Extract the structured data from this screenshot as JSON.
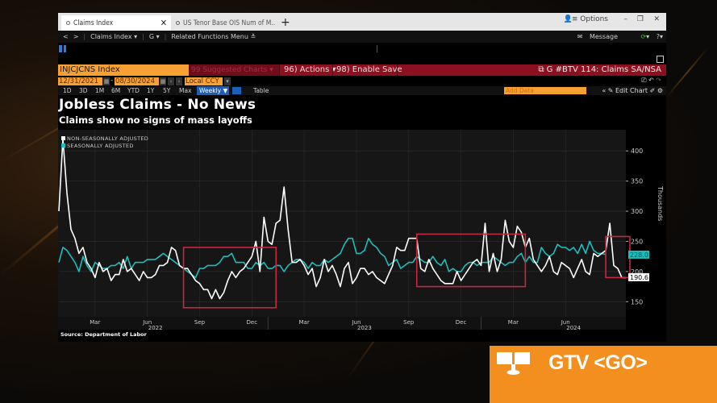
{
  "tabs": [
    {
      "label": "Claims Index",
      "active": true
    },
    {
      "label": "US Tenor Base OIS Num of M..",
      "active": false
    }
  ],
  "window_controls": {
    "options_label": "Options"
  },
  "navbar": {
    "back": "<",
    "forward": ">",
    "security": "Claims Index ▾",
    "g_menu": "G ▾",
    "related": "Related Functions Menu ≚",
    "message": "Message"
  },
  "toolbar": {
    "ticker": "INJCJCNS Index",
    "suggested": "99 Suggested Charts ▾",
    "actions": "96) Actions ▾",
    "enable_save": "98) Enable Save",
    "chart_id": "G #BTV 114: Claims SA/NSA"
  },
  "dates": {
    "start": "12/31/2021",
    "end": "08/30/2024",
    "currency": "Local CCY"
  },
  "periods": [
    "1D",
    "3D",
    "1M",
    "6M",
    "YTD",
    "1Y",
    "5Y",
    "Max"
  ],
  "frequency": "Weekly ▼",
  "table_label": "Table",
  "add_data_placeholder": "Add Data",
  "edit_chart_label": "Edit Chart",
  "source": "Source: Department of Labor",
  "gtv": {
    "label": "GTV <GO>"
  },
  "colors": {
    "nsa": "#ffffff",
    "sa": "#1fbcbc",
    "highlight": "#c8283c",
    "accent_orange": "#f7a033",
    "toolbar_red": "#8b1020"
  },
  "chart_data": {
    "type": "line",
    "title": "Jobless Claims - No News",
    "subtitle": "Claims show no signs of mass layoffs",
    "ylabel": "Thousands",
    "ylim": [
      125,
      435
    ],
    "yticks": [
      150,
      200,
      250,
      300,
      350,
      400
    ],
    "x_start": "2021-12-31",
    "x_end": "2024-08-30",
    "frequency": "weekly",
    "xtick_labels": [
      {
        "label": "Mar",
        "week": 9
      },
      {
        "label": "Jun",
        "week": 22
      },
      {
        "label": "Sep",
        "week": 35
      },
      {
        "label": "Dec",
        "week": 48
      },
      {
        "label": "Mar",
        "week": 61
      },
      {
        "label": "Jun",
        "week": 74
      },
      {
        "label": "Sep",
        "week": 87
      },
      {
        "label": "Dec",
        "week": 100
      },
      {
        "label": "Mar",
        "week": 113
      },
      {
        "label": "Jun",
        "week": 126
      }
    ],
    "year_labels": [
      {
        "label": "2022",
        "week": 24
      },
      {
        "label": "2023",
        "week": 76
      },
      {
        "label": "2024",
        "week": 128
      }
    ],
    "year_dividers": [
      52,
      105
    ],
    "legend": [
      "NON-SEASONALLY ADJUSTED",
      "SEASONALLY ADJUSTED"
    ],
    "legend_position": "top-left",
    "series": [
      {
        "name": "NON-SEASONALLY ADJUSTED",
        "color": "#ffffff",
        "last_value": 190.6,
        "values": [
          300,
          420,
          330,
          270,
          255,
          230,
          240,
          215,
          205,
          190,
          215,
          200,
          205,
          185,
          195,
          195,
          220,
          200,
          205,
          195,
          185,
          200,
          190,
          190,
          195,
          210,
          210,
          215,
          240,
          235,
          210,
          205,
          205,
          195,
          185,
          180,
          170,
          170,
          155,
          170,
          155,
          165,
          185,
          200,
          190,
          200,
          205,
          215,
          225,
          250,
          200,
          290,
          250,
          245,
          280,
          285,
          340,
          270,
          215,
          215,
          220,
          210,
          195,
          205,
          175,
          190,
          220,
          200,
          210,
          195,
          175,
          205,
          215,
          180,
          190,
          205,
          205,
          195,
          200,
          190,
          185,
          180,
          195,
          210,
          240,
          235,
          235,
          255,
          255,
          255,
          205,
          200,
          220,
          205,
          195,
          185,
          180,
          180,
          180,
          200,
          185,
          195,
          205,
          215,
          220,
          210,
          280,
          200,
          230,
          200,
          220,
          285,
          250,
          240,
          275,
          265,
          240,
          255,
          220,
          210,
          200,
          210,
          225,
          200,
          195,
          215,
          210,
          205,
          190,
          205,
          220,
          200,
          195,
          230,
          225,
          230,
          235,
          280,
          210,
          205,
          190,
          190
        ]
      },
      {
        "name": "SEASONALLY ADJUSTED",
        "color": "#1fbcbc",
        "last_value": 228.0,
        "values": [
          215,
          240,
          235,
          225,
          215,
          200,
          225,
          210,
          200,
          215,
          210,
          205,
          205,
          210,
          210,
          215,
          205,
          225,
          205,
          215,
          215,
          215,
          220,
          220,
          220,
          225,
          230,
          225,
          220,
          215,
          210,
          205,
          200,
          195,
          190,
          205,
          205,
          210,
          210,
          210,
          215,
          225,
          225,
          230,
          215,
          215,
          215,
          205,
          205,
          215,
          210,
          215,
          205,
          205,
          210,
          210,
          200,
          210,
          215,
          220,
          220,
          215,
          205,
          215,
          210,
          210,
          220,
          215,
          220,
          225,
          230,
          245,
          255,
          255,
          230,
          230,
          235,
          255,
          245,
          240,
          230,
          225,
          210,
          215,
          220,
          205,
          210,
          215,
          215,
          225,
          220,
          215,
          215,
          225,
          215,
          210,
          220,
          200,
          205,
          200,
          200,
          210,
          215,
          215,
          210,
          215,
          215,
          215,
          225,
          220,
          215,
          210,
          215,
          215,
          225,
          230,
          215,
          225,
          215,
          215,
          240,
          230,
          225,
          230,
          245,
          240,
          240,
          235,
          240,
          230,
          245,
          230,
          250,
          235,
          230,
          230,
          228
        ]
      }
    ],
    "highlight_boxes": [
      {
        "from_week": 31,
        "to_week": 54,
        "ymin": 140,
        "ymax": 240
      },
      {
        "from_week": 89,
        "to_week": 116,
        "ymin": 175,
        "ymax": 262
      },
      {
        "from_week": 136,
        "to_week": 142,
        "ymin": 190,
        "ymax": 258
      }
    ]
  }
}
